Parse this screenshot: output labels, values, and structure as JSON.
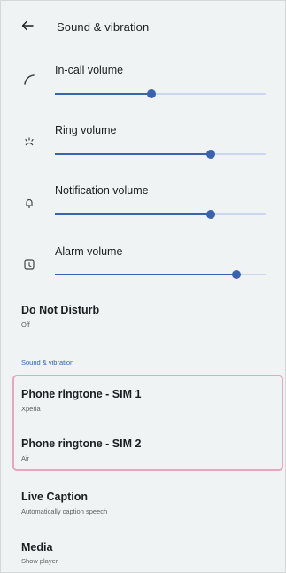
{
  "header": {
    "title": "Sound & vibration"
  },
  "volumes": [
    {
      "label": "In-call volume",
      "icon": "phone-call-icon",
      "level": 0.46
    },
    {
      "label": "Ring volume",
      "icon": "vibrate-ring-icon",
      "level": 0.74
    },
    {
      "label": "Notification volume",
      "icon": "bell-icon",
      "level": 0.74
    },
    {
      "label": "Alarm volume",
      "icon": "alarm-icon",
      "level": 0.86
    }
  ],
  "settings": {
    "dnd": {
      "title": "Do Not Disturb",
      "sub": "Off"
    },
    "section_label": "Sound & vibration",
    "ringtone1": {
      "title": "Phone ringtone - SIM 1",
      "sub": "Xperia"
    },
    "ringtone2": {
      "title": "Phone ringtone - SIM 2",
      "sub": "Air"
    },
    "live_caption": {
      "title": "Live Caption",
      "sub": "Automatically caption speech"
    },
    "media": {
      "title": "Media",
      "sub": "Show player"
    }
  },
  "colors": {
    "accent": "#3b62ac",
    "track": "#c9d7ef",
    "highlight": "#e6a6bb",
    "section": "#2d61c4"
  }
}
